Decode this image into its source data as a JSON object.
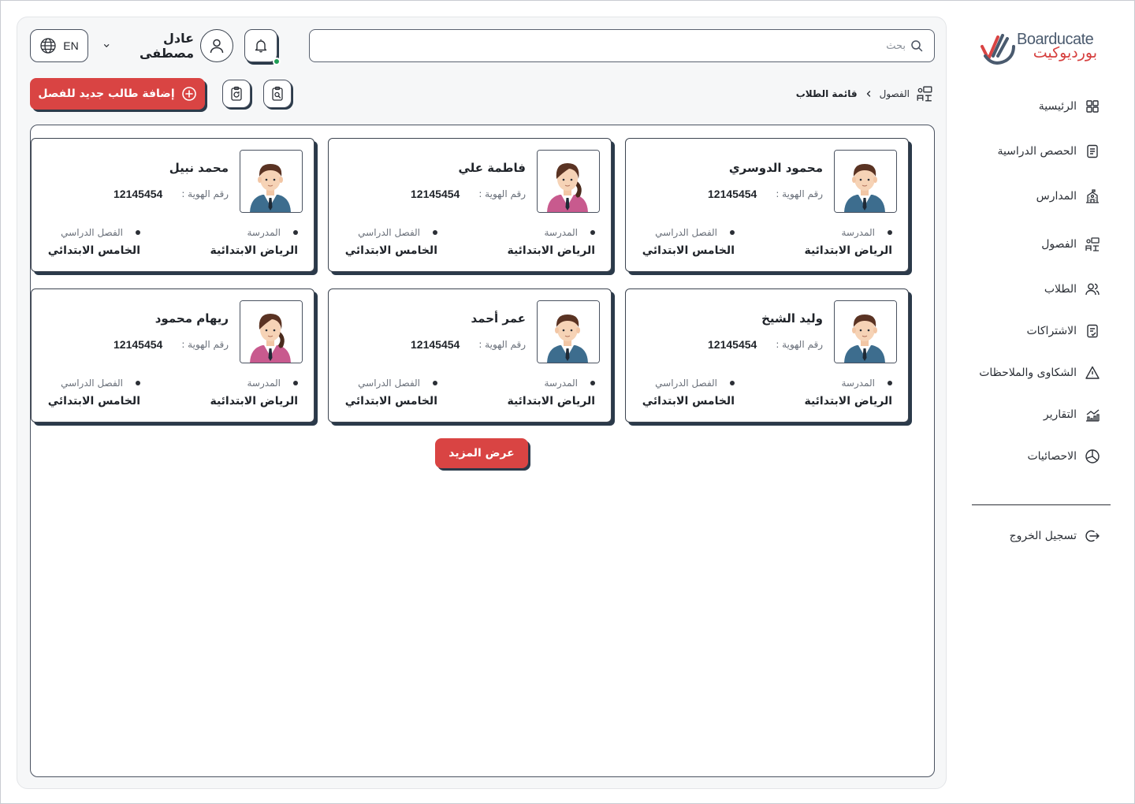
{
  "brand": {
    "name_en": "Boarducate",
    "name_ar": "بورديوكيت",
    "accent": "#d94443",
    "dark": "#2b3a4a"
  },
  "sidebar": {
    "items": [
      {
        "label": "الرئيسية",
        "icon": "grid-icon"
      },
      {
        "label": "الحصص الدراسية",
        "icon": "document-icon"
      },
      {
        "label": "المدارس",
        "icon": "school-icon"
      },
      {
        "label": "الفصول",
        "icon": "classroom-icon"
      },
      {
        "label": "الطلاب",
        "icon": "users-icon"
      },
      {
        "label": "الاشتراكات",
        "icon": "clipboard-check-icon"
      },
      {
        "label": "الشكاوى والملاحظات",
        "icon": "warning-icon"
      },
      {
        "label": "التقارير",
        "icon": "bar-chart-icon"
      },
      {
        "label": "الاحصائيات",
        "icon": "pie-chart-icon"
      }
    ],
    "logout": "تسجيل الخروج"
  },
  "header": {
    "search_placeholder": "بحث",
    "user_name": "عادل مصطفى",
    "language": "EN"
  },
  "toolbar": {
    "add_student": "إضافة طالب جديد للفصل"
  },
  "breadcrumb": {
    "parent": "الفصول",
    "current": "قائمة الطلاب"
  },
  "students": [
    {
      "name": "محمود الدوسري",
      "id_label": "رقم الهوية :",
      "id": "12145454",
      "school_label": "المدرسة",
      "school": "الرياض الابتدائية",
      "class_label": "الفصل الدراسي",
      "class": "الخامس الابتدائي",
      "gender": "male"
    },
    {
      "name": "فاطمة علي",
      "id_label": "رقم الهوية :",
      "id": "12145454",
      "school_label": "المدرسة",
      "school": "الرياض الابتدائية",
      "class_label": "الفصل الدراسي",
      "class": "الخامس الابتدائي",
      "gender": "female"
    },
    {
      "name": "محمد نبيل",
      "id_label": "رقم الهوية :",
      "id": "12145454",
      "school_label": "المدرسة",
      "school": "الرياض الابتدائية",
      "class_label": "الفصل الدراسي",
      "class": "الخامس الابتدائي",
      "gender": "male"
    },
    {
      "name": "وليد الشيخ",
      "id_label": "رقم الهوية :",
      "id": "12145454",
      "school_label": "المدرسة",
      "school": "الرياض الابتدائية",
      "class_label": "الفصل الدراسي",
      "class": "الخامس الابتدائي",
      "gender": "male"
    },
    {
      "name": "عمر أحمد",
      "id_label": "رقم الهوية :",
      "id": "12145454",
      "school_label": "المدرسة",
      "school": "الرياض الابتدائية",
      "class_label": "الفصل الدراسي",
      "class": "الخامس الابتدائي",
      "gender": "male"
    },
    {
      "name": "ريهام محمود",
      "id_label": "رقم الهوية :",
      "id": "12145454",
      "school_label": "المدرسة",
      "school": "الرياض الابتدائية",
      "class_label": "الفصل الدراسي",
      "class": "الخامس الابتدائي",
      "gender": "female"
    }
  ],
  "show_more": "عرض المزيد"
}
